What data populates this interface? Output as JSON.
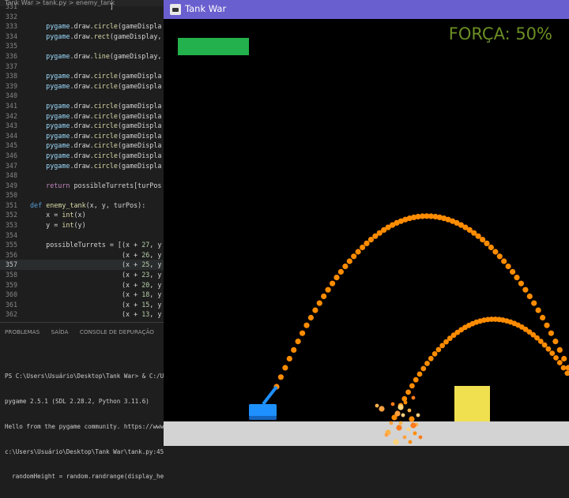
{
  "editor": {
    "tab_text": "Tank War > tank.py > enemy_tank",
    "lines": [
      {
        "n": "331",
        "t": "                    ]"
      },
      {
        "n": "332",
        "t": ""
      },
      {
        "n": "333",
        "t": "    pygame.draw.circle(gameDispla"
      },
      {
        "n": "334",
        "t": "    pygame.draw.rect(gameDisplay,"
      },
      {
        "n": "335",
        "t": ""
      },
      {
        "n": "336",
        "t": "    pygame.draw.line(gameDisplay,"
      },
      {
        "n": "337",
        "t": ""
      },
      {
        "n": "338",
        "t": "    pygame.draw.circle(gameDispla"
      },
      {
        "n": "339",
        "t": "    pygame.draw.circle(gameDispla"
      },
      {
        "n": "340",
        "t": ""
      },
      {
        "n": "341",
        "t": "    pygame.draw.circle(gameDispla"
      },
      {
        "n": "342",
        "t": "    pygame.draw.circle(gameDispla"
      },
      {
        "n": "343",
        "t": "    pygame.draw.circle(gameDispla"
      },
      {
        "n": "344",
        "t": "    pygame.draw.circle(gameDispla"
      },
      {
        "n": "345",
        "t": "    pygame.draw.circle(gameDispla"
      },
      {
        "n": "346",
        "t": "    pygame.draw.circle(gameDispla"
      },
      {
        "n": "347",
        "t": "    pygame.draw.circle(gameDispla"
      },
      {
        "n": "348",
        "t": ""
      },
      {
        "n": "349",
        "t": "    return possibleTurrets[turPos"
      },
      {
        "n": "350",
        "t": ""
      },
      {
        "n": "351",
        "t": "def enemy_tank(x, y, turPos):"
      },
      {
        "n": "352",
        "t": "    x = int(x)"
      },
      {
        "n": "353",
        "t": "    y = int(y)"
      },
      {
        "n": "354",
        "t": ""
      },
      {
        "n": "355",
        "t": "    possibleTurrets = [(x + 27, y"
      },
      {
        "n": "356",
        "t": "                       (x + 26, y"
      },
      {
        "n": "357",
        "t": "                       (x + 25, y"
      },
      {
        "n": "358",
        "t": "                       (x + 23, y"
      },
      {
        "n": "359",
        "t": "                       (x + 20, y"
      },
      {
        "n": "360",
        "t": "                       (x + 18, y"
      },
      {
        "n": "361",
        "t": "                       (x + 15, y"
      },
      {
        "n": "362",
        "t": "                       (x + 13, y"
      }
    ],
    "current_line": "357"
  },
  "panel": {
    "tabs": [
      "PROBLEMAS",
      "SAÍDA",
      "CONSOLE DE DEPURAÇÃO",
      "T"
    ],
    "terminal": [
      "PS C:\\Users\\Usuário\\Desktop\\Tank War> & C:/U",
      "pygame 2.5.1 (SDL 2.28.2, Python 3.11.6)",
      "Hello from the pygame community. https://www",
      "c:\\Users\\Usuário\\Desktop\\Tank War\\tank.py:45",
      "  randomHeight = random.randrange(display_he"
    ]
  },
  "game": {
    "window_title": "Tank War",
    "power_text": "FORÇA: 50%",
    "power_percent": 50,
    "colors": {
      "title_bar": "#6a5fcf",
      "sky": "#000000",
      "ground": "#d3d3d3",
      "health_bar": "#22b14c",
      "power_text": "#6b8e23",
      "tank": "#1e90ff",
      "trajectory": "#ff8c00",
      "obstacle": "#f0e050"
    }
  }
}
